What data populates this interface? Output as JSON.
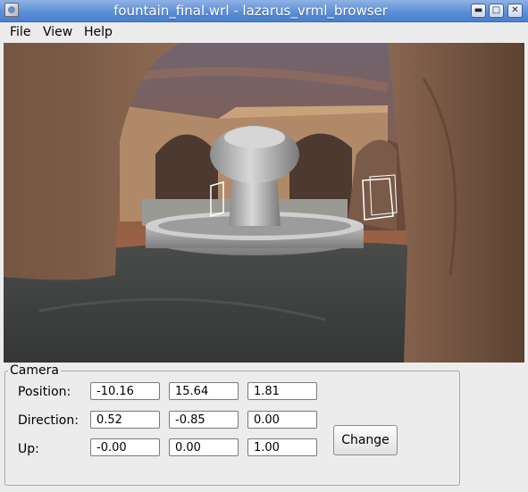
{
  "window": {
    "title": "fountain_final.wrl - lazarus_vrml_browser",
    "controls": {
      "minimize_icon": "minimize-icon",
      "maximize_icon": "maximize-icon",
      "close_icon": "close-icon"
    }
  },
  "menu": {
    "items": [
      {
        "label": "File"
      },
      {
        "label": "View"
      },
      {
        "label": "Help"
      }
    ]
  },
  "viewport": {
    "scene": "courtyard with arched walls and a marble fountain under a dusk sky"
  },
  "camera": {
    "title": "Camera",
    "position": {
      "label": "Position:",
      "x": "-10.16",
      "y": "15.64",
      "z": "1.81"
    },
    "direction": {
      "label": "Direction:",
      "x": "0.52",
      "y": "-0.85",
      "z": "0.00"
    },
    "up": {
      "label": "Up:",
      "x": "-0.00",
      "y": "0.00",
      "z": "1.00"
    },
    "change_label": "Change"
  },
  "colors": {
    "titlebar": "#5d8fd6",
    "window_bg": "#ececec",
    "sky": "#7a5a4a",
    "stone": "#b08a68"
  }
}
